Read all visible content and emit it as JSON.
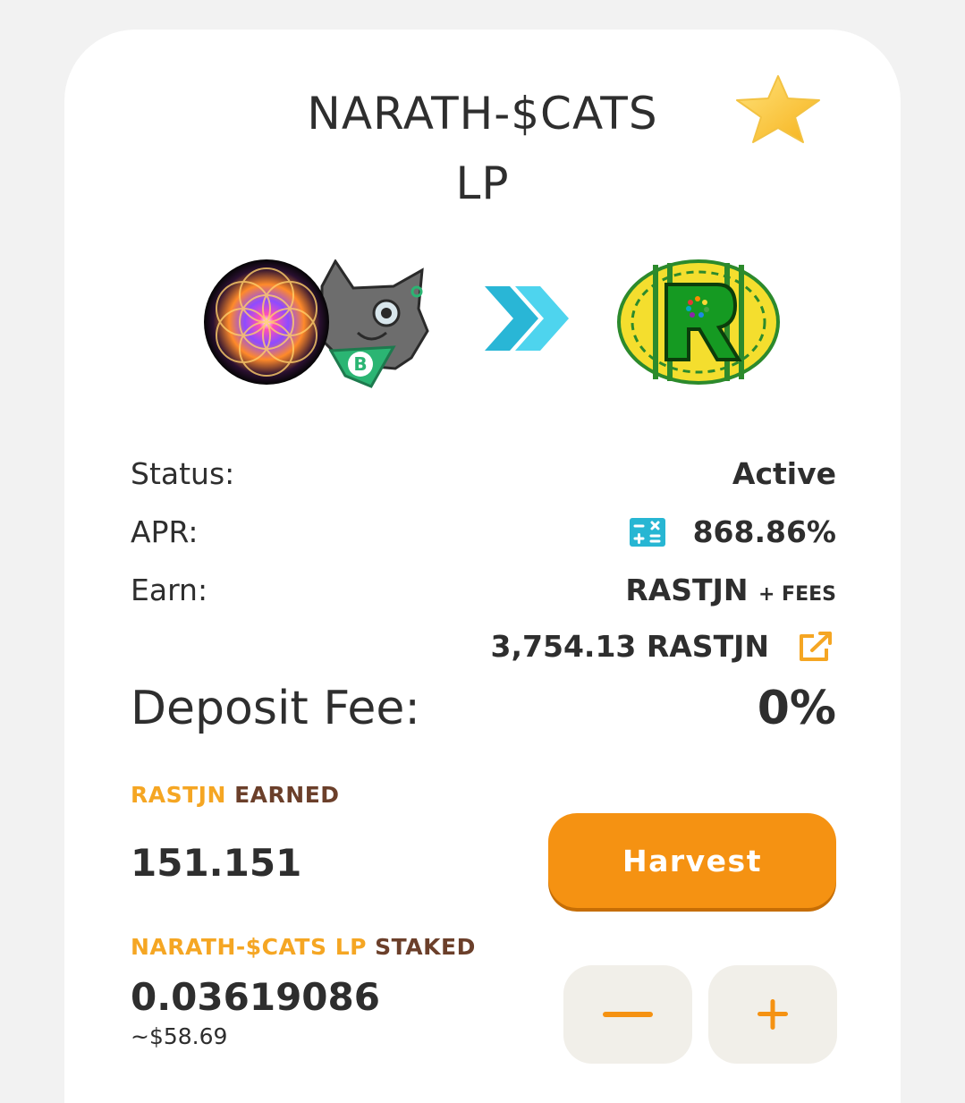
{
  "header": {
    "title_line1": "NARATH-$CATS",
    "title_line2": "LP",
    "favorite_icon": "star-icon"
  },
  "tokens": {
    "stake_icon": "narath-cats-lp-token-icon",
    "arrow_icon": "double-chevron-right-icon",
    "earn_icon": "rastjn-token-icon"
  },
  "details": {
    "status_label": "Status:",
    "status_value": "Active",
    "apr_label": "APR:",
    "apr_icon": "calculator-icon",
    "apr_value": "868.86%",
    "earn_label": "Earn:",
    "earn_token": "RASTJN",
    "earn_suffix": "+ FEES",
    "total_rewards": "3,754.13 RASTJN",
    "total_rewards_icon": "external-link-icon",
    "deposit_fee_label": "Deposit Fee:",
    "deposit_fee_value": "0%"
  },
  "earned": {
    "token_label": "RASTJN",
    "suffix_label": "EARNED",
    "amount": "151.151",
    "harvest_label": "Harvest"
  },
  "staked": {
    "token_label": "NARATH-$CATS LP",
    "suffix_label": "STAKED",
    "amount": "0.03619086",
    "usd_value": "~$58.69",
    "minus_icon": "minus-icon",
    "plus_icon": "plus-icon"
  },
  "colors": {
    "accent": "#f59212",
    "label_orange": "#f5a623",
    "label_brown": "#6b3f2a",
    "arrow_teal": "#29b6d6"
  }
}
